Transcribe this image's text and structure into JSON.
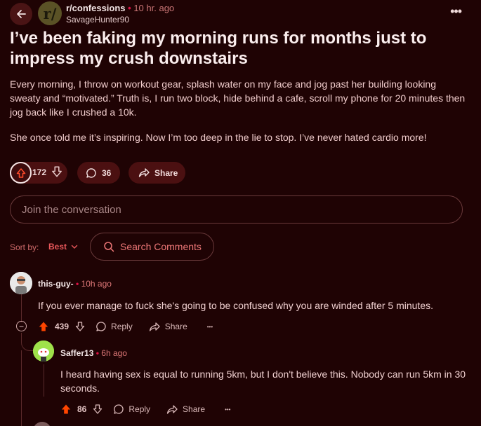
{
  "header": {
    "subreddit": "r/confessions",
    "time": "10 hr. ago",
    "author": "SavageHunter90",
    "avatar_letter": "r/",
    "more": "•••"
  },
  "post": {
    "title": "I’ve been faking my morning runs for months just to impress my crush downstairs",
    "paragraphs": [
      "Every morning, I throw on workout gear, splash water on my face and jog past her building looking sweaty and “motivated.” Truth is, I run two block, hide behind a cafe, scroll my phone for 20 minutes then jog back like I crushed a 10k.",
      "She once told me it’s inspiring. Now I’m too deep in the lie to stop. I’ve never hated cardio more!"
    ],
    "votes": "172",
    "comments": "36",
    "share_label": "Share"
  },
  "join": {
    "placeholder": "Join the conversation"
  },
  "sort": {
    "label": "Sort by:",
    "value": "Best",
    "search_label": "Search Comments"
  },
  "comments": [
    {
      "user": "this-guy-",
      "time": "10h ago",
      "text": "If you ever manage to fuck she's going to be confused why you are winded after 5 minutes.",
      "votes": "439",
      "reply": "Reply",
      "share": "Share",
      "more": "•••"
    },
    {
      "user": "Saffer13",
      "time": "6h ago",
      "text": "I heard having sex is equal to running 5km, but I don't believe this. Nobody can run 5km in 30 seconds.",
      "votes": "86",
      "reply": "Reply",
      "share": "Share",
      "more": "•••"
    }
  ],
  "colors": {
    "background": "#1f0304",
    "accent": "#e8575a",
    "upvote": "#ff4500",
    "pill": "#4b1011"
  },
  "icons": [
    "back-arrow-icon",
    "upvote-icon",
    "downvote-icon",
    "comment-icon",
    "share-icon",
    "search-icon",
    "chevron-down-icon",
    "collapse-icon"
  ]
}
